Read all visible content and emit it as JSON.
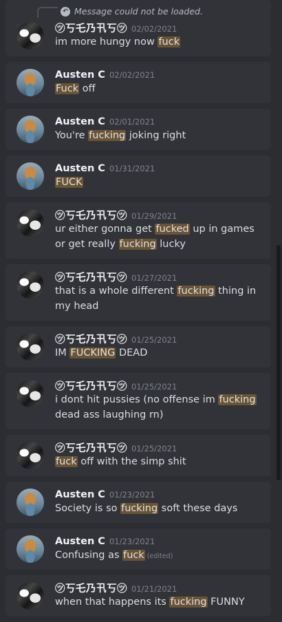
{
  "reply": {
    "text": "Message could not be loaded."
  },
  "messages": [
    {
      "author": "㋡丂乇乃卂丂㋡",
      "avatar": "dark-bw-avatar",
      "date": "02/02/2021",
      "parts": [
        "im more hungy now ",
        "fuck",
        ""
      ],
      "edited": ""
    },
    {
      "author": "Austen C",
      "avatar": "dog-avatar",
      "date": "02/02/2021",
      "parts": [
        "",
        "Fuck",
        " off"
      ],
      "edited": ""
    },
    {
      "author": "Austen C",
      "avatar": "dog-avatar",
      "date": "02/01/2021",
      "parts": [
        "You're ",
        "fucking",
        " joking right"
      ],
      "edited": ""
    },
    {
      "author": "Austen C",
      "avatar": "dog-avatar",
      "date": "01/31/2021",
      "parts": [
        "",
        "FUCK",
        ""
      ],
      "edited": ""
    },
    {
      "author": "㋡丂乇乃卂丂㋡",
      "avatar": "dark-bw-avatar",
      "date": "01/29/2021",
      "parts": [
        "ur either gonna get ",
        "fucked",
        " up in games or get really ",
        "fucking",
        " lucky"
      ],
      "edited": ""
    },
    {
      "author": "㋡丂乇乃卂丂㋡",
      "avatar": "dark-bw-avatar",
      "date": "01/27/2021",
      "parts": [
        "that is a whole different ",
        "fucking",
        " thing in my head"
      ],
      "edited": ""
    },
    {
      "author": "㋡丂乇乃卂丂㋡",
      "avatar": "dark-bw-avatar",
      "date": "01/25/2021",
      "parts": [
        "IM ",
        "FUCKING",
        " DEAD"
      ],
      "edited": ""
    },
    {
      "author": "㋡丂乇乃卂丂㋡",
      "avatar": "dark-bw-avatar",
      "date": "01/25/2021",
      "parts": [
        "i dont hit pussies (no offense im ",
        "fucking",
        " dead ass laughing rn)"
      ],
      "edited": ""
    },
    {
      "author": "㋡丂乇乃卂丂㋡",
      "avatar": "dark-bw-avatar",
      "date": "01/25/2021",
      "parts": [
        "",
        "fuck",
        " off with the simp shit"
      ],
      "edited": ""
    },
    {
      "author": "Austen C",
      "avatar": "dog-avatar",
      "date": "01/23/2021",
      "parts": [
        "Society is so ",
        "fucking",
        " soft these days"
      ],
      "edited": ""
    },
    {
      "author": "Austen C",
      "avatar": "dog-avatar",
      "date": "01/23/2021",
      "parts": [
        "Confusing as ",
        "fuck",
        ""
      ],
      "edited": "(edited)"
    },
    {
      "author": "㋡丂乇乃卂丂㋡",
      "avatar": "dark-bw-avatar",
      "date": "01/21/2021",
      "parts": [
        "when that happens its ",
        "fucking",
        " FUNNY"
      ],
      "edited": ""
    }
  ]
}
